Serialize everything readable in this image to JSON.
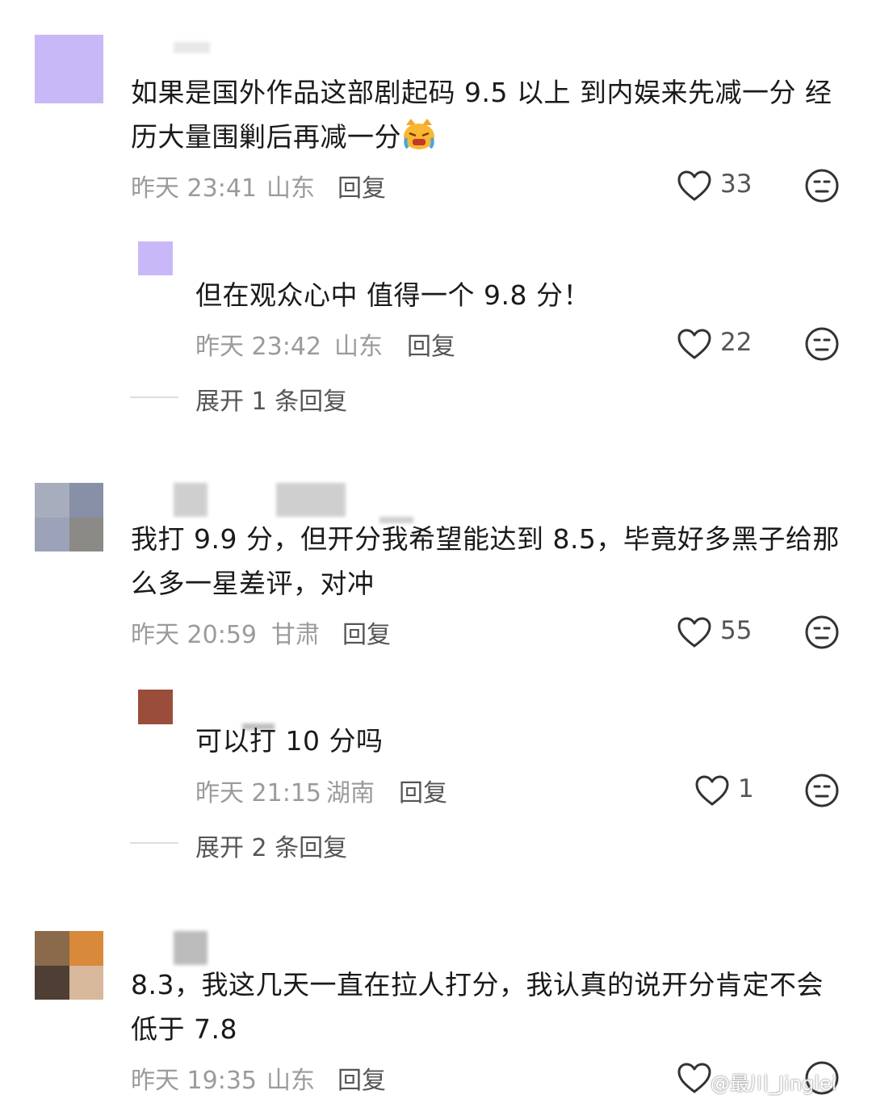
{
  "comments": [
    {
      "avatar_colors": [
        "#c9b8f7"
      ],
      "text": "如果是国外作品这部剧起码 9.5 以上 到内娱来先减一分 经历大量围剿后再减一分",
      "emoji": "crying-cat-emoji",
      "time": "昨天 23:41",
      "location": "山东",
      "reply_label": "回复",
      "likes": "33",
      "replies": [
        {
          "avatar_colors": [
            "#c9b8f7"
          ],
          "text": "但在观众心中 值得一个 9.8 分！",
          "time": "昨天 23:42",
          "location": "山东",
          "reply_label": "回复",
          "likes": "22"
        }
      ],
      "expand_label": "展开 1 条回复"
    },
    {
      "avatar_colors": [
        "#a7adbc",
        "#8790a6",
        "#9ca2b8",
        "#8b8a86"
      ],
      "text": "我打 9.9 分，但开分我希望能达到 8.5，毕竟好多黑子给那么多一星差评，对冲",
      "time": "昨天 20:59",
      "location": "甘肃",
      "reply_label": "回复",
      "likes": "55",
      "replies": [
        {
          "avatar_colors": [
            "#9a4d3b"
          ],
          "text": "可以打 10 分吗",
          "time": "昨天 21:15",
          "location": "湖南",
          "reply_label": "回复",
          "likes": "1"
        }
      ],
      "expand_label": "展开 2 条回复"
    },
    {
      "avatar_colors": [
        "#8a6a4a",
        "#d9893a",
        "#4e3e34",
        "#d7b89a"
      ],
      "text": "8.3，我这几天一直在拉人打分，我认真的说开分肯定不会低于 7.8",
      "time": "昨天 19:35",
      "location": "山东",
      "reply_label": "回复",
      "likes": ""
    }
  ],
  "watermark": "@最川_Jinglei"
}
